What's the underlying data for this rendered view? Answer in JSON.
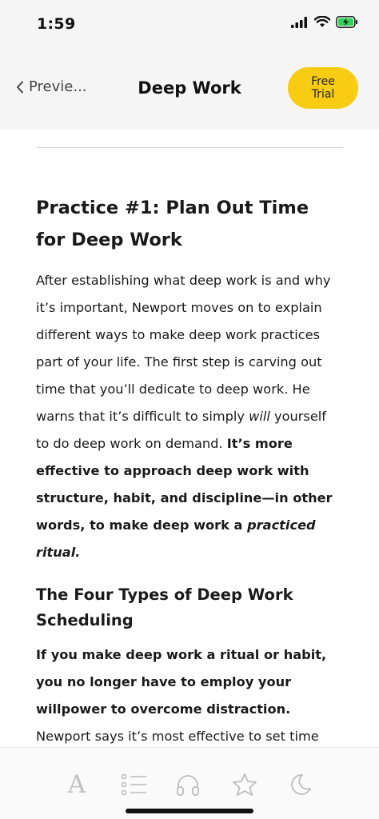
{
  "status_bar": {
    "time": "1:59"
  },
  "nav": {
    "back_label": "Previe...",
    "title": "Deep Work",
    "trial_line1": "Free",
    "trial_line2": "Trial",
    "trial_color": "#f7cc12"
  },
  "article": {
    "heading": "Practice #1: Plan Out Time for Deep Work",
    "para1": {
      "t1": "After establishing what deep work is and why it’s important, Newport moves on to explain different ways to make deep work practices part of your life. The first step is carving out time that you’ll dedicate to deep work. He warns that it’s difficult to simply ",
      "t2": "will",
      "t3": " yourself to do deep work on demand. ",
      "t4": "It’s more effective to approach deep work with structure, habit, and discipline—in other words, to make deep work a ",
      "t5": "practiced ritual.",
      "t6": ""
    },
    "subheading": "The Four Types of Deep Work Scheduling",
    "para2": {
      "t1": "If you make deep work a ritual or habit, you no longer have to employ your willpower to overcome distraction.",
      "t2": " Newport says it’s most effective to set time aside specifically"
    }
  },
  "tab_bar": {
    "icons": [
      "font-icon",
      "list-icon",
      "headphones-icon",
      "star-icon",
      "moon-icon"
    ],
    "font_glyph": "A"
  }
}
